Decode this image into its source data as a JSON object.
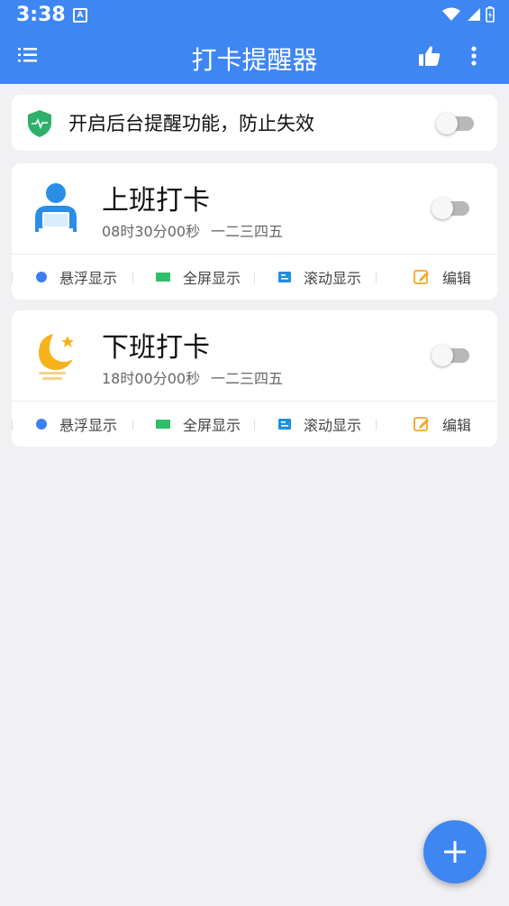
{
  "status_bar": {
    "time": "3:38",
    "notification_glyph": "A"
  },
  "app_bar": {
    "title": "打卡提醒器"
  },
  "background_notice": {
    "label": "开启后台提醒功能，防止失效",
    "enabled": false
  },
  "alarms": [
    {
      "name": "上班打卡",
      "time": "08时30分00秒",
      "days": "一二三四五",
      "enabled": false,
      "icon": "worker-icon",
      "actions": {
        "float": "悬浮显示",
        "fullscreen": "全屏显示",
        "scroll": "滚动显示",
        "edit": "编辑"
      }
    },
    {
      "name": "下班打卡",
      "time": "18时00分00秒",
      "days": "一二三四五",
      "enabled": false,
      "icon": "moon-icon",
      "actions": {
        "float": "悬浮显示",
        "fullscreen": "全屏显示",
        "scroll": "滚动显示",
        "edit": "编辑"
      }
    }
  ],
  "colors": {
    "primary": "#3e86f2",
    "float_dot": "#3e7ff0",
    "fullscreen": "#2fbf6a",
    "scroll": "#1e8fde",
    "edit": "#f5a623",
    "shield": "#2fb06a",
    "moon": "#f5b21b"
  }
}
